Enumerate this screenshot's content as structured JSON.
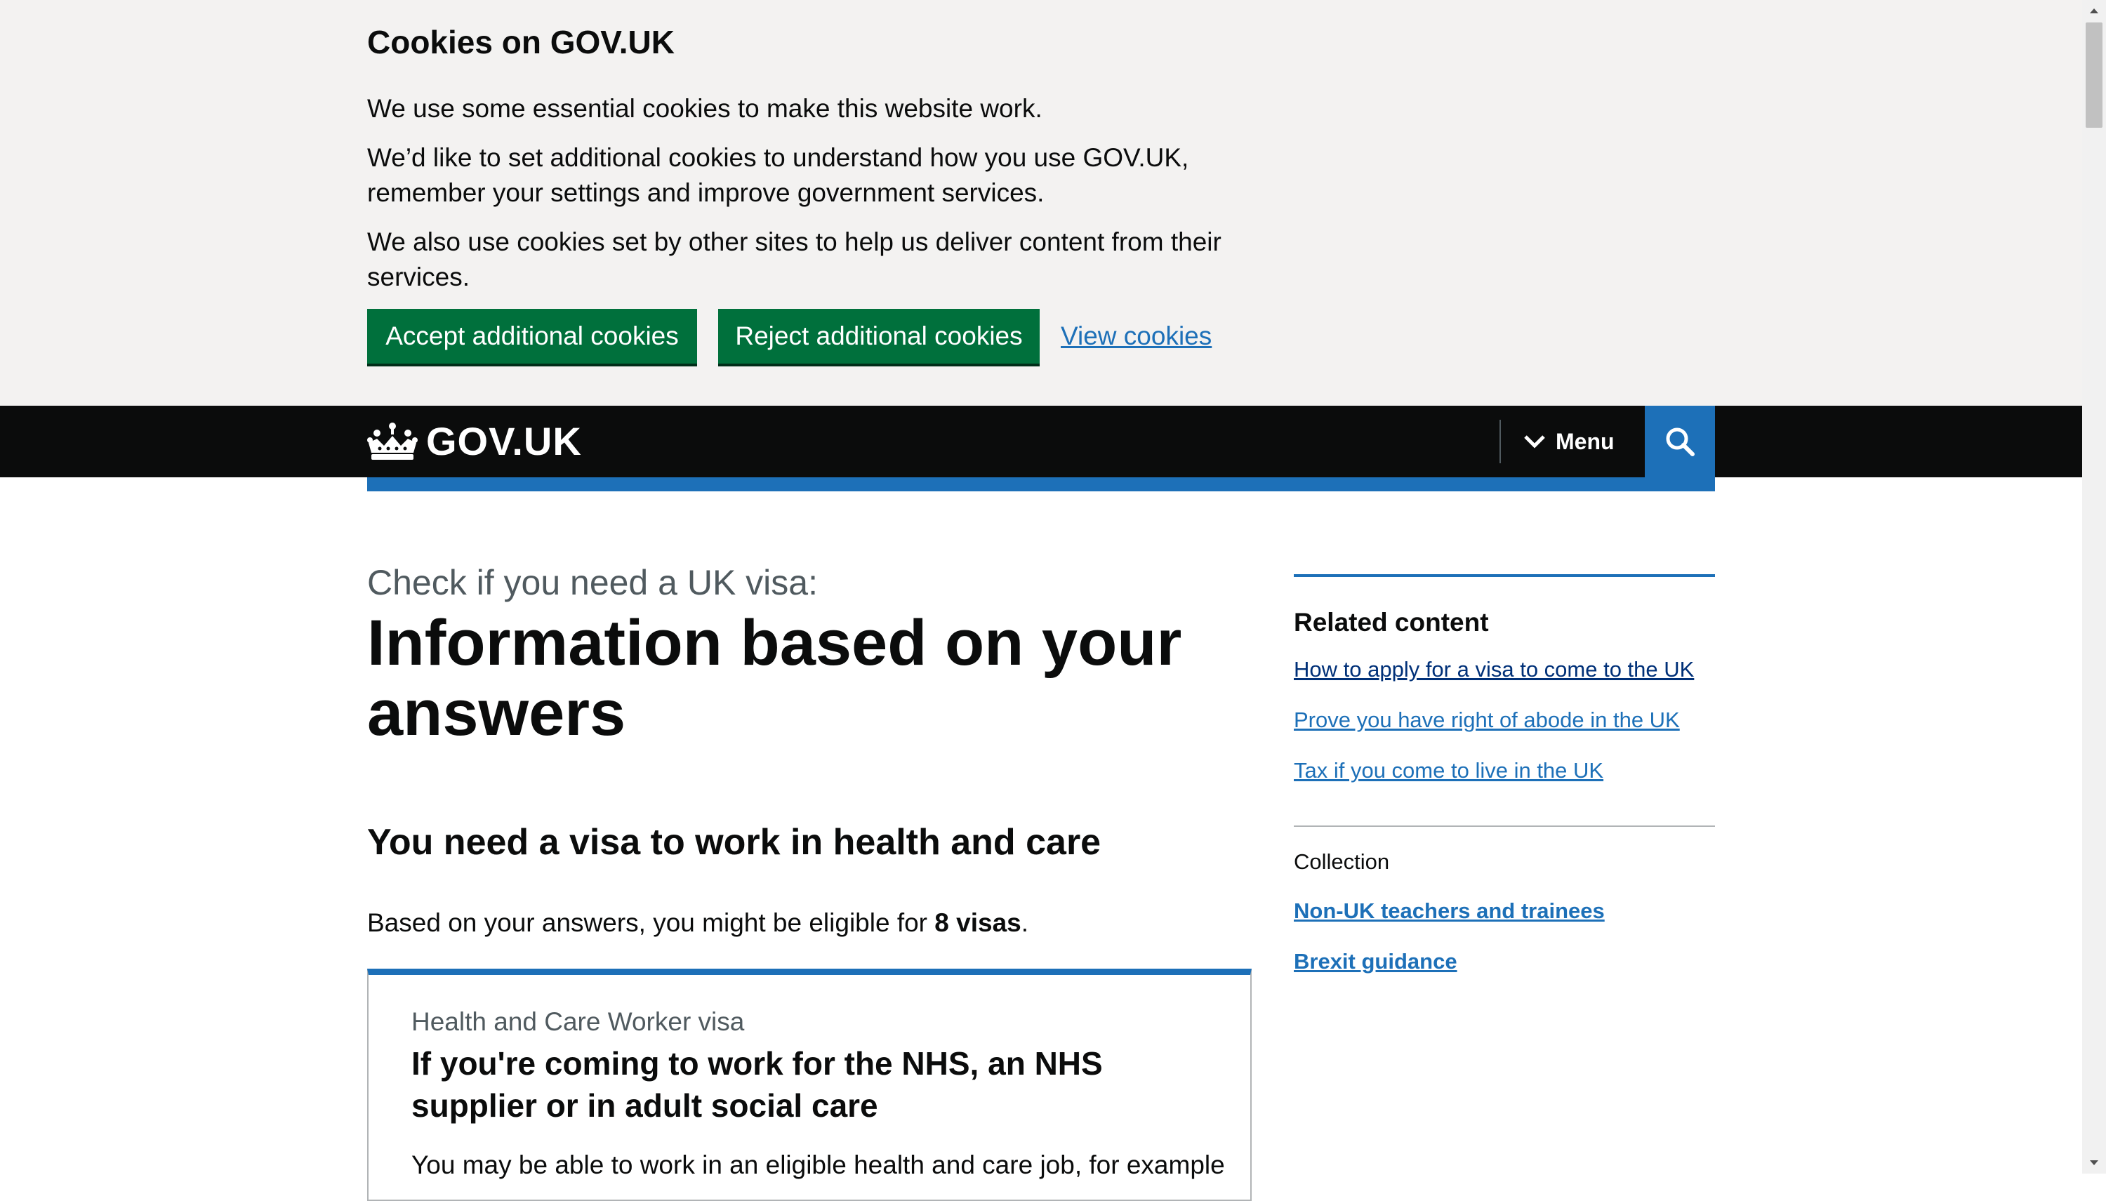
{
  "cookie_banner": {
    "title": "Cookies on GOV.UK",
    "paragraphs": [
      "We use some essential cookies to make this website work.",
      "We’d like to set additional cookies to understand how you use GOV.UK, remember your settings and improve government services.",
      "We also use cookies set by other sites to help us deliver content from their services."
    ],
    "accept_label": "Accept additional cookies",
    "reject_label": "Reject additional cookies",
    "view_label": "View cookies"
  },
  "header": {
    "logo_text": "GOV.UK",
    "logo_icon": "crown-icon",
    "menu_label": "Menu",
    "menu_icon": "chevron-down-icon",
    "search_icon": "search-icon"
  },
  "main": {
    "caption": "Check if you need a UK visa:",
    "title": "Information based on your answers",
    "section_heading": "You need a visa to work in health and care",
    "eligibility_prefix": "Based on your answers, you might be eligible for ",
    "eligibility_count": "8 visas",
    "eligibility_suffix": ".",
    "visa_card": {
      "caption": "Health and Care Worker visa",
      "heading": "If you're coming to work for the NHS, an NHS supplier or in adult social care",
      "body": "You may be able to work in an eligible health and care job, for example"
    }
  },
  "sidebar": {
    "related_title": "Related content",
    "related_links": [
      "How to apply for a visa to come to the UK",
      "Prove you have right of abode in the UK",
      "Tax if you come to live in the UK"
    ],
    "collection_label": "Collection",
    "collection_links": [
      "Non-UK teachers and trainees",
      "Brexit guidance"
    ]
  },
  "colors": {
    "header_bg": "#0b0c0c",
    "brand_blue": "#1d70b8",
    "button_green": "#00703c",
    "banner_bg": "#f3f2f1"
  }
}
